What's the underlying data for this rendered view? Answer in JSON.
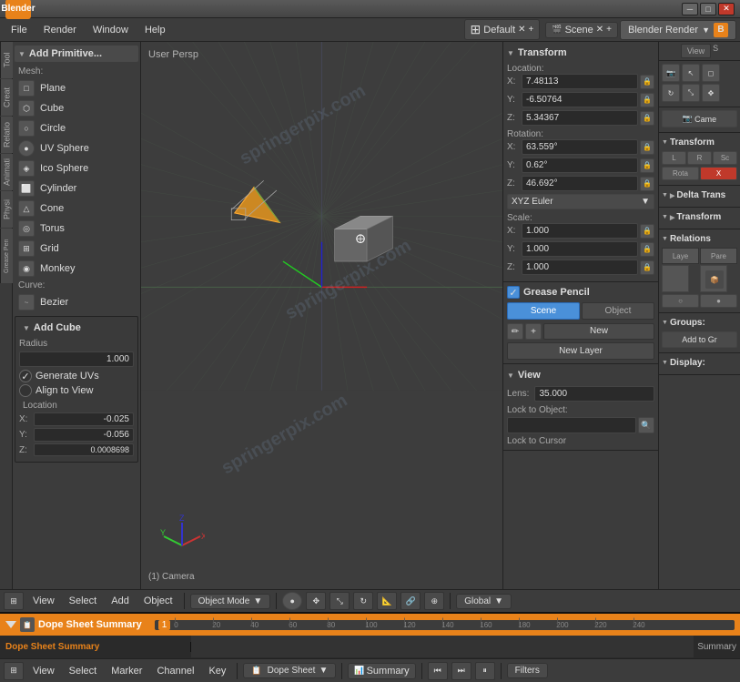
{
  "titlebar": {
    "title": "Blender",
    "min_label": "─",
    "max_label": "□",
    "close_label": "✕"
  },
  "menubar": {
    "logo": "B",
    "file_label": "File",
    "render_label": "Render",
    "window_label": "Window",
    "help_label": "Help",
    "layout_label": "Default",
    "scene_label": "Scene",
    "engine_label": "Blender Render"
  },
  "left_panel": {
    "header": "Add Primitive...",
    "tabs": [
      "Tool",
      "Creat",
      "Relatio",
      "Animati",
      "Physi",
      "Grease Pen"
    ],
    "mesh_label": "Mesh:",
    "items": [
      {
        "label": "Plane",
        "icon": "□"
      },
      {
        "label": "Cube",
        "icon": "⬡"
      },
      {
        "label": "Circle",
        "icon": "○"
      },
      {
        "label": "UV Sphere",
        "icon": "●"
      },
      {
        "label": "Ico Sphere",
        "icon": "◈"
      },
      {
        "label": "Cylinder",
        "icon": "⬜"
      },
      {
        "label": "Cone",
        "icon": "△"
      },
      {
        "label": "Torus",
        "icon": "◎"
      },
      {
        "label": "Grid",
        "icon": "⊞"
      },
      {
        "label": "Monkey",
        "icon": "◉"
      }
    ],
    "curve_label": "Curve:",
    "curve_items": [
      {
        "label": "Bezier",
        "icon": "~"
      }
    ],
    "add_cube": {
      "header": "Add Cube",
      "radius_label": "Radius",
      "radius_value": "1.000",
      "generate_uvs_label": "Generate UVs",
      "align_to_view_label": "Align to View",
      "location_label": "Location",
      "x_label": "X:",
      "x_value": "-0.025",
      "y_label": "Y:",
      "y_value": "-0.056",
      "z_label": "Z:",
      "z_value": "0.0008698"
    }
  },
  "viewport": {
    "label": "User Persp",
    "camera_label": "(1) Camera"
  },
  "transform_panel": {
    "header": "Transform",
    "location_label": "Location:",
    "loc_x_label": "X:",
    "loc_x_value": "7.48113",
    "loc_y_label": "Y:",
    "loc_y_value": "-6.50764",
    "loc_z_label": "Z:",
    "loc_z_value": "5.34367",
    "rotation_label": "Rotation:",
    "rot_x_label": "X:",
    "rot_x_value": "63.559°",
    "rot_y_label": "Y:",
    "rot_y_value": "0.62°",
    "rot_z_label": "Z:",
    "rot_z_value": "46.692°",
    "rotation_mode": "XYZ Euler",
    "scale_label": "Scale:",
    "scale_x_label": "X:",
    "scale_x_value": "1.000",
    "scale_y_label": "Y:",
    "scale_y_value": "1.000",
    "scale_z_label": "Z:",
    "scale_z_value": "1.000"
  },
  "grease_pencil": {
    "header": "Grease Pencil",
    "scene_btn": "Scene",
    "object_btn": "Object",
    "draw_icon": "✏",
    "move_icon": "+",
    "new_btn": "New",
    "new_layer_btn": "New Layer"
  },
  "view_section": {
    "header": "View",
    "lens_label": "Lens:",
    "lens_value": "35.000",
    "lock_object_label": "Lock to Object:",
    "lock_cursor_label": "Lock to Cursor"
  },
  "far_right": {
    "view_tab": "View",
    "transform_header": "Transform",
    "delta_trans_header": "Delta Trans",
    "relations_header": "Relations",
    "groups_header": "Groups:",
    "display_header": "Display:",
    "camera_btn": "Came",
    "lrsc": [
      "L",
      "R",
      "Sc"
    ],
    "rota_label": "Rota",
    "x_label": "X",
    "table_headers": [
      "Laye",
      "Pare"
    ],
    "add_to_group_btn": "Add to Gr"
  },
  "bottom_toolbar": {
    "view_label": "View",
    "select_label": "Select",
    "add_label": "Add",
    "object_label": "Object",
    "mode_label": "Object Mode",
    "global_label": "Global"
  },
  "dopesheet": {
    "title": "Dope Sheet Summary",
    "summary_label": "Summary",
    "ruler_marks": [
      "0",
      "20",
      "40",
      "60",
      "80",
      "100",
      "120",
      "140",
      "160",
      "180",
      "200",
      "220",
      "240"
    ],
    "current_frame": "1",
    "view_label": "View",
    "select_label": "Select",
    "marker_label": "Marker",
    "channel_label": "Channel",
    "key_label": "Key",
    "mode_label": "Dope Sheet",
    "filters_label": "Filters"
  },
  "colors": {
    "accent_orange": "#e8821a",
    "accent_blue": "#4a90d9",
    "bg_dark": "#2a2a2a",
    "bg_mid": "#3c3c3c",
    "bg_light": "#4a4a4a",
    "border": "#222",
    "text_light": "#ddd",
    "text_dim": "#aaa"
  }
}
